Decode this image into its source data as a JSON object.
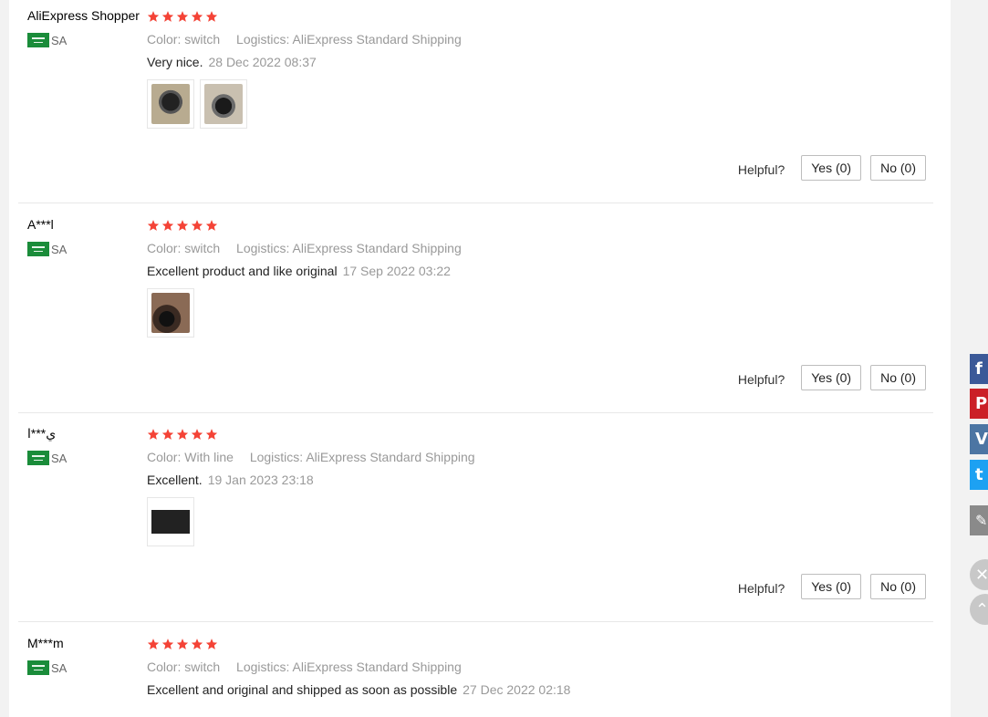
{
  "reviews": [
    {
      "user": "AliExpress Shopper",
      "country": "SA",
      "stars": 5,
      "attributes": [
        {
          "label": "Color:",
          "value": "switch"
        },
        {
          "label": "Logistics:",
          "value": "AliExpress Standard Shipping"
        }
      ],
      "text": "Very nice.",
      "date": "28 Dec 2022 08:37",
      "photo_count": 2,
      "helpful_label": "Helpful?",
      "yes_label": "Yes (0)",
      "no_label": "No (0)"
    },
    {
      "user": "A***l",
      "country": "SA",
      "stars": 5,
      "attributes": [
        {
          "label": "Color:",
          "value": "switch"
        },
        {
          "label": "Logistics:",
          "value": "AliExpress Standard Shipping"
        }
      ],
      "text": "Excellent product and like original",
      "date": "17 Sep 2022 03:22",
      "photo_count": 1,
      "helpful_label": "Helpful?",
      "yes_label": "Yes (0)",
      "no_label": "No (0)"
    },
    {
      "user": "ي***ا",
      "country": "SA",
      "stars": 5,
      "attributes": [
        {
          "label": "Color:",
          "value": "With line"
        },
        {
          "label": "Logistics:",
          "value": "AliExpress Standard Shipping"
        }
      ],
      "text": "Excellent.",
      "date": "19 Jan 2023 23:18",
      "photo_count": 1,
      "helpful_label": "Helpful?",
      "yes_label": "Yes (0)",
      "no_label": "No (0)"
    },
    {
      "user": "M***m",
      "country": "SA",
      "stars": 5,
      "attributes": [
        {
          "label": "Color:",
          "value": "switch"
        },
        {
          "label": "Logistics:",
          "value": "AliExpress Standard Shipping"
        }
      ],
      "text": "Excellent and original and shipped as soon as possible",
      "date": "27 Dec 2022 02:18"
    }
  ],
  "share": {
    "facebook_glyph": "f",
    "pinterest_glyph": "P",
    "vk_glyph": "V",
    "twitter_glyph": "t",
    "edit_glyph": "✎",
    "close_glyph": "✕",
    "top_glyph": "⌃"
  },
  "colors": {
    "star": "#f44336",
    "flag": "#1a8c3a"
  }
}
